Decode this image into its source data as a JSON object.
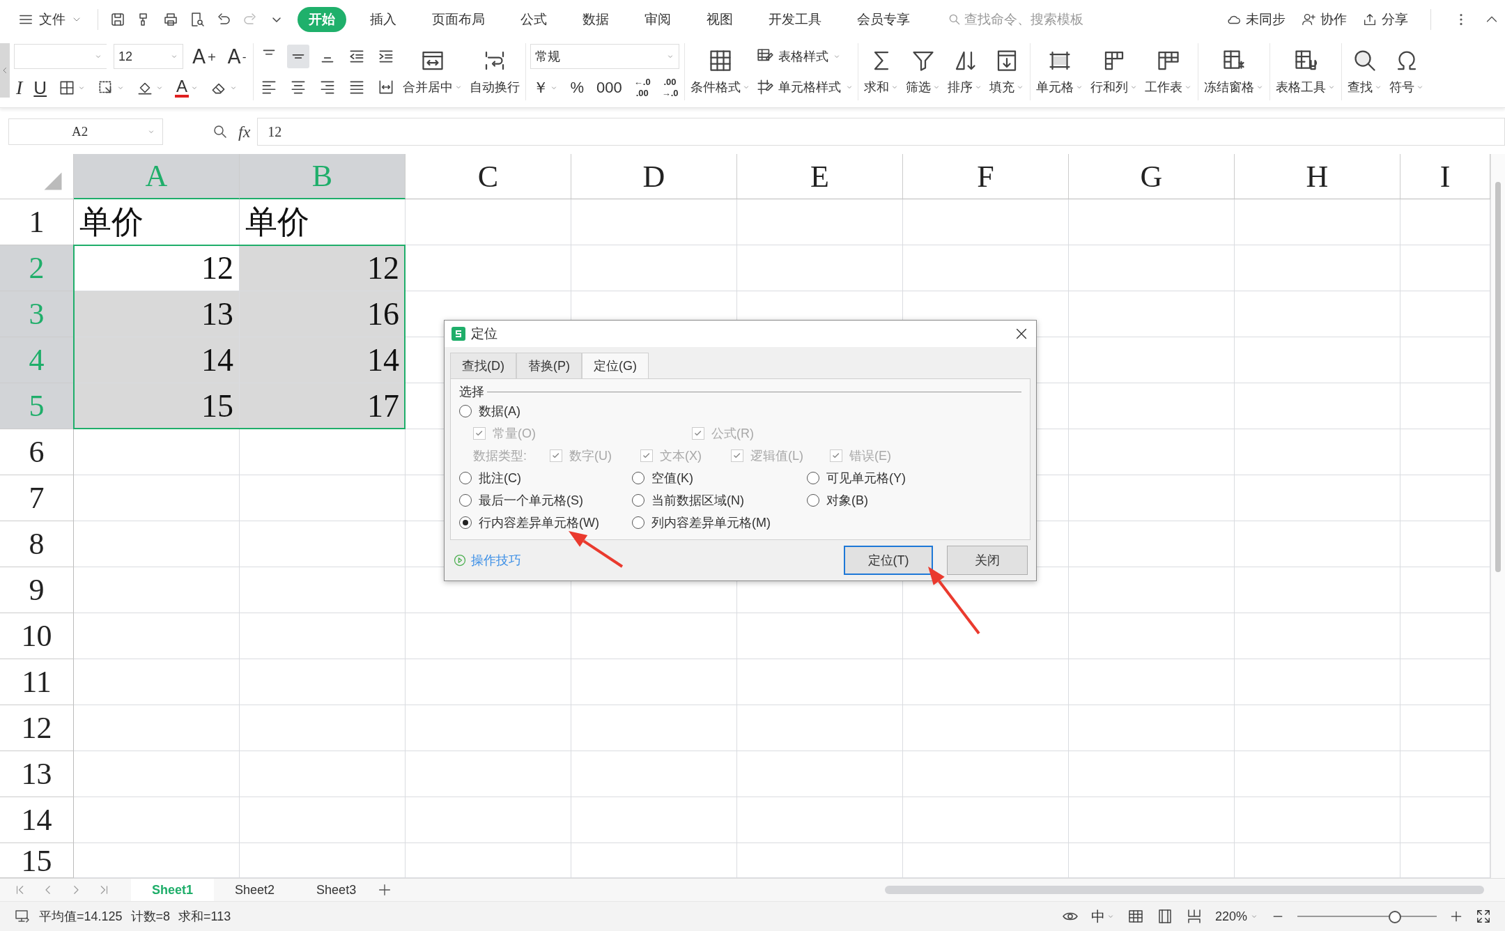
{
  "menu_bar": {
    "file_menu": "文件",
    "tabs": [
      {
        "label": "开始",
        "selected": true
      },
      {
        "label": "插入",
        "selected": false
      },
      {
        "label": "页面布局",
        "selected": false
      },
      {
        "label": "公式",
        "selected": false
      },
      {
        "label": "数据",
        "selected": false
      },
      {
        "label": "审阅",
        "selected": false
      },
      {
        "label": "视图",
        "selected": false
      },
      {
        "label": "开发工具",
        "selected": false
      },
      {
        "label": "会员专享",
        "selected": false
      }
    ],
    "search": {
      "placeholder": "查找命令、搜索模板"
    },
    "actions": [
      "未同步",
      "协作",
      "分享"
    ]
  },
  "ribbon": {
    "font_size": "12",
    "grow_shrink": [
      "A$^{+}$",
      "A$^{-}$"
    ],
    "text_styles": [
      "I",
      "U"
    ],
    "font_color": "A",
    "wrap_tools": [
      "合并居中",
      "自动换行"
    ],
    "number_format": "常规",
    "number_symbols": [
      "￥",
      "%",
      "000"
    ],
    "decimal_tools": [
      {
        "top": "←.0",
        "bottom": ".00"
      },
      {
        "top": ".00",
        "bottom": "→.0"
      }
    ],
    "conditional_format": "条件格式",
    "style_tools": [
      "表格样式",
      "单元格样式"
    ],
    "edit_tools": [
      "求和",
      "筛选",
      "排序",
      "填充"
    ],
    "cell_tools": [
      "单元格",
      "行和列",
      "工作表"
    ],
    "freeze": "冻结窗格",
    "table_tools": "表格工具",
    "find_tools": [
      "查找",
      "符号"
    ]
  },
  "formula_bar": {
    "name_box": "A2",
    "fx": "fx",
    "value": "12"
  },
  "sheet": {
    "columns": [
      {
        "label": "A",
        "selected": true
      },
      {
        "label": "B",
        "selected": true
      },
      {
        "label": "C",
        "selected": false
      },
      {
        "label": "D",
        "selected": false
      },
      {
        "label": "E",
        "selected": false
      },
      {
        "label": "F",
        "selected": false
      },
      {
        "label": "G",
        "selected": false
      },
      {
        "label": "H",
        "selected": false
      },
      {
        "label": "I",
        "selected": false
      }
    ],
    "rows": [
      {
        "number": "1",
        "selected": false,
        "cells": [
          {
            "kind": "text",
            "text": "单价",
            "selected": false
          },
          {
            "kind": "text",
            "text": "单价",
            "selected": false
          }
        ]
      },
      {
        "number": "2",
        "selected": true,
        "cells": [
          {
            "kind": "number",
            "text": "12",
            "selected": true,
            "active": true
          },
          {
            "kind": "number",
            "text": "12",
            "selected": true,
            "active": false
          }
        ]
      },
      {
        "number": "3",
        "selected": true,
        "cells": [
          {
            "kind": "number",
            "text": "13",
            "selected": true,
            "active": false
          },
          {
            "kind": "number",
            "text": "16",
            "selected": true,
            "active": false
          }
        ]
      },
      {
        "number": "4",
        "selected": true,
        "cells": [
          {
            "kind": "number",
            "text": "14",
            "selected": true,
            "active": false
          },
          {
            "kind": "number",
            "text": "14",
            "selected": true,
            "active": false
          }
        ]
      },
      {
        "number": "5",
        "selected": true,
        "cells": [
          {
            "kind": "number",
            "text": "15",
            "selected": true,
            "active": false
          },
          {
            "kind": "number",
            "text": "17",
            "selected": true,
            "active": false
          }
        ]
      },
      {
        "number": "6",
        "selected": false
      },
      {
        "number": "7",
        "selected": false
      },
      {
        "number": "8",
        "selected": false
      },
      {
        "number": "9",
        "selected": false
      },
      {
        "number": "10",
        "selected": false
      },
      {
        "number": "11",
        "selected": false
      },
      {
        "number": "12",
        "selected": false
      },
      {
        "number": "13",
        "selected": false
      },
      {
        "number": "14",
        "selected": false
      },
      {
        "number": "15",
        "selected": false
      }
    ]
  },
  "sheet_tabs": [
    {
      "label": "Sheet1",
      "selected": true
    },
    {
      "label": "Sheet2",
      "selected": false
    },
    {
      "label": "Sheet3",
      "selected": false
    }
  ],
  "status_bar": {
    "stats": [
      "平均值=14.125",
      "计数=8",
      "求和=113"
    ],
    "input_mode": "中",
    "zoom": "220%",
    "zoom_slider": {
      "level": 0.7
    }
  },
  "dialog": {
    "title": "定位",
    "tabs": [
      {
        "label": "查找(D)",
        "selected": false
      },
      {
        "label": "替换(P)",
        "selected": false
      },
      {
        "label": "定位(G)",
        "selected": true
      }
    ],
    "group": {
      "title": "选择",
      "data_option": {
        "label": "数据(A)",
        "selected": false
      },
      "data_subtypes": [
        {
          "label": "常量(O)",
          "checked": true,
          "disabled": true
        },
        {
          "label": "公式(R)",
          "checked": true,
          "disabled": true
        }
      ],
      "type_label": {
        "label": "数据类型:",
        "disabled": true
      },
      "data_types": [
        {
          "label": "数字(U)",
          "checked": true,
          "disabled": true
        },
        {
          "label": "文本(X)",
          "checked": true,
          "disabled": true
        },
        {
          "label": "逻辑值(L)",
          "checked": true,
          "disabled": true
        },
        {
          "label": "错误(E)",
          "checked": true,
          "disabled": true
        }
      ],
      "options": [
        {
          "label": "批注(C)",
          "selected": false
        },
        {
          "label": "空值(K)",
          "selected": false
        },
        {
          "label": "可见单元格(Y)",
          "selected": false
        },
        {
          "label": "最后一个单元格(S)",
          "selected": false
        },
        {
          "label": "当前数据区域(N)",
          "selected": false
        },
        {
          "label": "对象(B)",
          "selected": false
        },
        {
          "label": "行内容差异单元格(W)",
          "selected": true
        },
        {
          "label": "列内容差异单元格(M)",
          "selected": false
        }
      ]
    },
    "tips_link": "操作技巧",
    "buttons": [
      {
        "label": "定位(T)",
        "default": true
      },
      {
        "label": "关闭",
        "default": false
      }
    ]
  }
}
